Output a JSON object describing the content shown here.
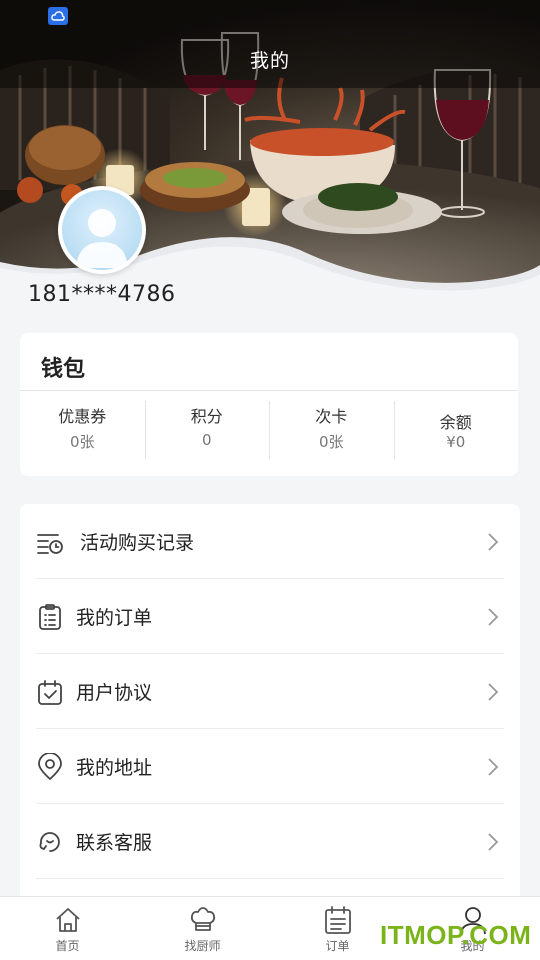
{
  "header": {
    "title": "我的"
  },
  "profile": {
    "phone": "181****4786"
  },
  "wallet": {
    "title": "钱包",
    "stats": [
      {
        "label": "优惠券",
        "value": "0张"
      },
      {
        "label": "积分",
        "value": "0"
      },
      {
        "label": "次卡",
        "value": "0张"
      },
      {
        "label": "余额",
        "value": "¥0"
      }
    ]
  },
  "menu": {
    "items": [
      {
        "label": "活动购买记录",
        "icon": "purchase-history-icon"
      },
      {
        "label": "我的订单",
        "icon": "clipboard-icon"
      },
      {
        "label": "用户协议",
        "icon": "agreement-icon"
      },
      {
        "label": "我的地址",
        "icon": "location-pin-icon"
      },
      {
        "label": "联系客服",
        "icon": "customer-service-icon"
      }
    ]
  },
  "tabbar": {
    "items": [
      {
        "label": "首页",
        "icon": "home-icon",
        "active": false
      },
      {
        "label": "找厨师",
        "icon": "chef-hat-icon",
        "active": false
      },
      {
        "label": "订单",
        "icon": "order-list-icon",
        "active": false
      },
      {
        "label": "我的",
        "icon": "user-icon",
        "active": true
      }
    ]
  },
  "watermark": "ITMOP.COM",
  "colors": {
    "accent": "#2b6fe6",
    "watermark": "#7bb31a",
    "background": "#f4f5f7"
  }
}
